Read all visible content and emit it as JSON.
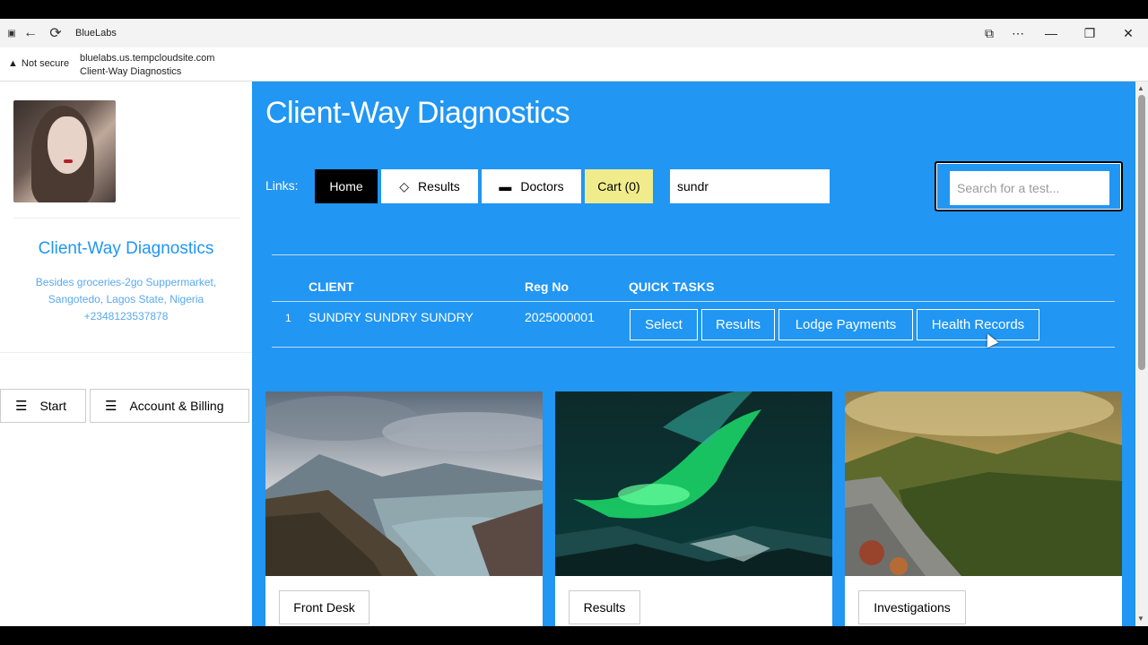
{
  "browser": {
    "tab_title": "BlueLabs",
    "security_label": "Not secure",
    "url": "bluelabs.us.tempcloudsite.com",
    "page_title": "Client-Way Diagnostics"
  },
  "sidebar": {
    "title": "Client-Way Diagnostics",
    "address_line1": "Besides groceries-2go Suppermarket,",
    "address_line2": "Sangotedo, Lagos State, Nigeria",
    "phone": "+2348123537878",
    "buttons": {
      "start": "Start",
      "account": "Account & Billing"
    }
  },
  "main": {
    "title": "Client-Way Diagnostics",
    "links_label": "Links:",
    "nav": {
      "home": "Home",
      "results": "Results",
      "doctors": "Doctors",
      "cart": "Cart (0)"
    },
    "client_search_value": "sundr",
    "test_search_placeholder": "Search for a test..."
  },
  "table": {
    "headers": {
      "client": "CLIENT",
      "reg_no": "Reg No",
      "quick_tasks": "QUICK TASKS"
    },
    "rows": [
      {
        "index": "1",
        "client": "SUNDRY SUNDRY SUNDRY",
        "reg_no": "2025000001"
      }
    ],
    "actions": {
      "select": "Select",
      "results": "Results",
      "lodge_payments": "Lodge Payments",
      "health_records": "Health Records"
    }
  },
  "cards": [
    {
      "label": "Front Desk"
    },
    {
      "label": "Results"
    },
    {
      "label": "Investigations"
    }
  ],
  "colors": {
    "primary": "#2196f3",
    "cart_bg": "#f0ec8c"
  }
}
